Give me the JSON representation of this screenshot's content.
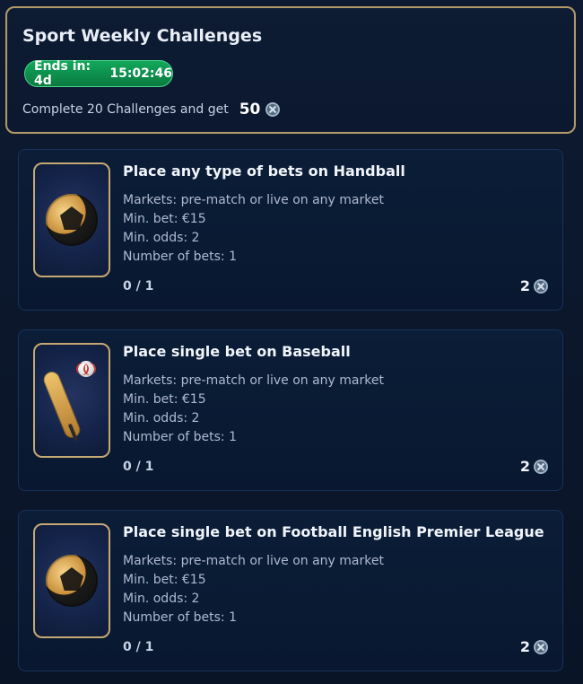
{
  "header": {
    "title": "Sport Weekly Challenges",
    "timer_label": "Ends in: 4d",
    "timer_value": "15:02:46",
    "subtitle_prefix": "Complete 20 Challenges and get",
    "reward_total": "50",
    "reward_icon": "coin-icon"
  },
  "challenges": [
    {
      "title": "Place any type of bets on Handball",
      "markets": "Markets: pre-match or live on any market",
      "min_bet": "Min. bet: €15",
      "min_odds": "Min. odds: 2",
      "number_of_bets": "Number of bets: 1",
      "progress": "0 / 1",
      "reward": "2",
      "thumb": "handball-icon"
    },
    {
      "title": "Place single bet on Baseball",
      "markets": "Markets: pre-match or live on any market",
      "min_bet": "Min. bet: €15",
      "min_odds": "Min. odds: 2",
      "number_of_bets": "Number of bets: 1",
      "progress": "0 / 1",
      "reward": "2",
      "thumb": "baseball-bat-icon"
    },
    {
      "title": "Place single bet on Football English Premier League",
      "markets": "Markets: pre-match or live on any market",
      "min_bet": "Min. bet: €15",
      "min_odds": "Min. odds: 2",
      "number_of_bets": "Number of bets: 1",
      "progress": "0 / 1",
      "reward": "2",
      "thumb": "football-icon"
    }
  ],
  "colors": {
    "accent_gold": "#c6a874",
    "timer_green": "#12a85b",
    "background": "#0b1426"
  }
}
